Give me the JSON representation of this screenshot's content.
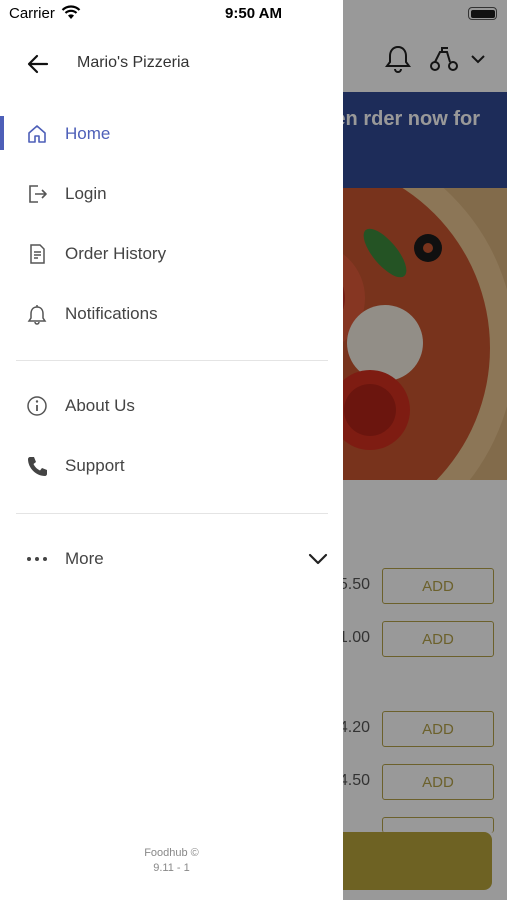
{
  "status_bar": {
    "carrier": "Carrier",
    "time": "9:50 AM"
  },
  "drawer": {
    "restaurant_name": "Mario's Pizzeria",
    "menu": [
      {
        "label": "Home",
        "icon": "home-icon",
        "active": true
      },
      {
        "label": "Login",
        "icon": "login-icon",
        "active": false
      },
      {
        "label": "Order History",
        "icon": "order-history-icon",
        "active": false
      },
      {
        "label": "Notifications",
        "icon": "bell-icon",
        "active": false
      }
    ],
    "secondary": [
      {
        "label": "About Us",
        "icon": "info-icon"
      },
      {
        "label": "Support",
        "icon": "phone-icon"
      }
    ],
    "more_label": "More",
    "footer_line1": "Foodhub ©",
    "footer_line2": "9.11 - 1"
  },
  "background_app": {
    "banner_text": "ed and will open rder now for",
    "menu_items": [
      {
        "price": "5.50",
        "button": "ADD"
      },
      {
        "price": "1.00",
        "button": "ADD"
      },
      {
        "price": "4.20",
        "button": "ADD"
      },
      {
        "price": "4.50",
        "button": "ADD"
      }
    ]
  },
  "colors": {
    "accent": "#4d5fb8",
    "banner": "#314a94",
    "add_button": "#b4a24a",
    "checkout_bar": "#b8a33b"
  }
}
